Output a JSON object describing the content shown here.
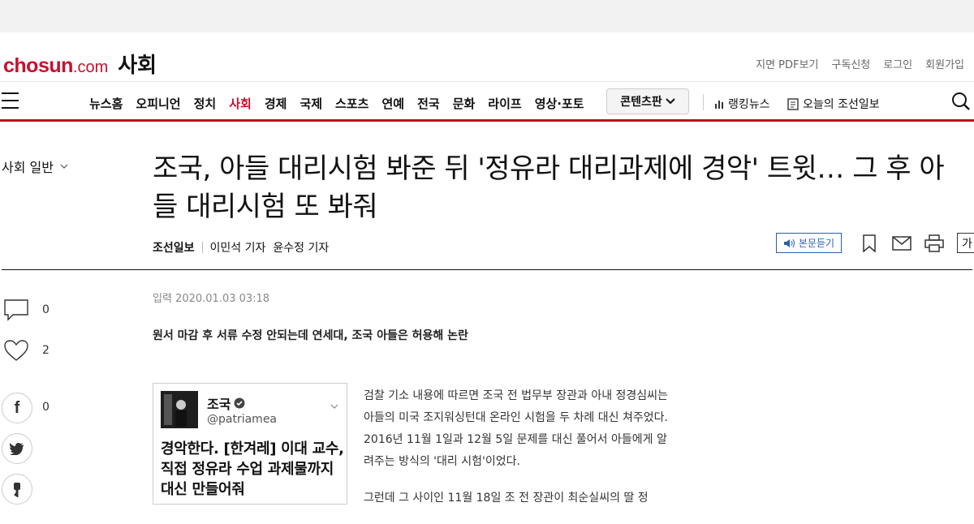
{
  "header": {
    "logo_brand": "chosun",
    "logo_dotcom": ".com",
    "section": "사회",
    "util_links": [
      "지면 PDF보기",
      "구독신청",
      "로그인",
      "회원가입"
    ]
  },
  "nav": {
    "items": [
      "뉴스홈",
      "오피니언",
      "정치",
      "사회",
      "경제",
      "국제",
      "스포츠",
      "연예",
      "전국",
      "문화",
      "라이프",
      "영상·포토"
    ],
    "active": "사회",
    "content_button": "콘텐츠판",
    "ranking": "랭킹뉴스",
    "today_paper": "오늘의 조선일보"
  },
  "article": {
    "category": "사회 일반",
    "title": "조국, 아들 대리시험 봐준 뒤 '정유라 대리과제에 경악' 트윗… 그 후 아들 대리시험 또 봐줘",
    "paper": "조선일보",
    "reporters": [
      "이민석 기자",
      "윤수정 기자"
    ],
    "listen_label": "본문듣기",
    "font_label": "가",
    "date": "입력 2020.01.03 03:18",
    "subtitle": "원서 마감 후 서류 수정 안되는데 연세대, 조국 아들은 허용해 논란",
    "paragraphs": [
      "검찰 기소 내용에 따르면 조국 전 법무부 장관과 아내 정경심씨는 아들의 미국 조지워싱턴대 온라인 시험을 두 차례 대신 쳐주었다. 2016년 11월 1일과 12월 5일 문제를 대신 풀어서 아들에게 알려주는 방식의 '대리 시험'이었다.",
      "그런데 그 사이인 11월 18일 조 전 장관이 최순실씨의 딸 정"
    ]
  },
  "social": {
    "comments": "0",
    "likes": "2",
    "facebook_shares": "0"
  },
  "tweet": {
    "name": "조국",
    "handle": "@patriamea",
    "text": "경악한다. [한겨레] 이대 교수, 직접 정유라 수업 과제물까지 대신 만들어줘"
  },
  "colors": {
    "brand_red": "#c8102e",
    "nav_underline": "#b4101f",
    "listen_blue": "#2a5db0"
  }
}
